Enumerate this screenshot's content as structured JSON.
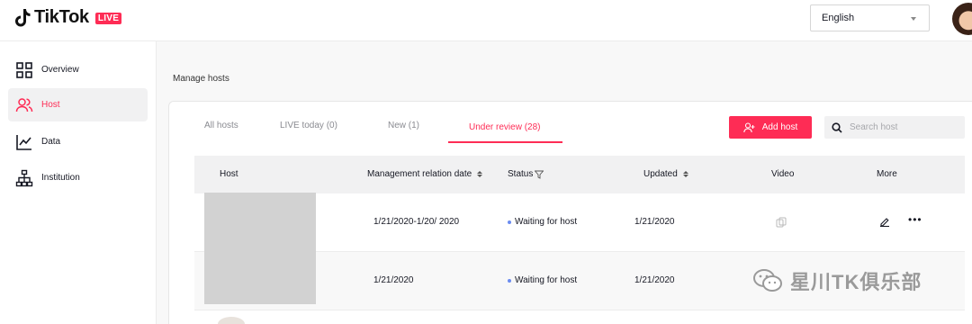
{
  "header": {
    "brand": "TikTok",
    "badge": "LIVE",
    "language": "English",
    "avatar_icon": "user-avatar"
  },
  "sidebar": {
    "items": [
      {
        "label": "Overview",
        "icon": "grid-icon"
      },
      {
        "label": "Host",
        "icon": "users-icon",
        "active": true
      },
      {
        "label": "Data",
        "icon": "line-chart-icon"
      },
      {
        "label": "Institution",
        "icon": "org-chart-icon"
      }
    ]
  },
  "main": {
    "title": "Manage hosts",
    "tabs": [
      {
        "label": "All hosts"
      },
      {
        "label": "LIVE today (0)"
      },
      {
        "label": "New (1)"
      },
      {
        "label": "Under review (28)",
        "active": true
      }
    ],
    "add_button": "Add host",
    "search_placeholder": "Search host",
    "table": {
      "columns": [
        "Host",
        "Management relation date",
        "Status",
        "Updated",
        "Video",
        "More"
      ],
      "rows": [
        {
          "date": "1/21/2020-1/20/ 2020",
          "status": "Waiting for host",
          "updated": "1/21/2020"
        },
        {
          "date": "1/21/2020",
          "status": "Waiting for host",
          "updated": "1/21/2020"
        }
      ]
    }
  },
  "watermark": "星川TK俱乐部",
  "colors": {
    "accent": "#fe2c55",
    "status_dot": "#6b8cf0",
    "sidebar_active_bg": "#f1f1f2"
  }
}
